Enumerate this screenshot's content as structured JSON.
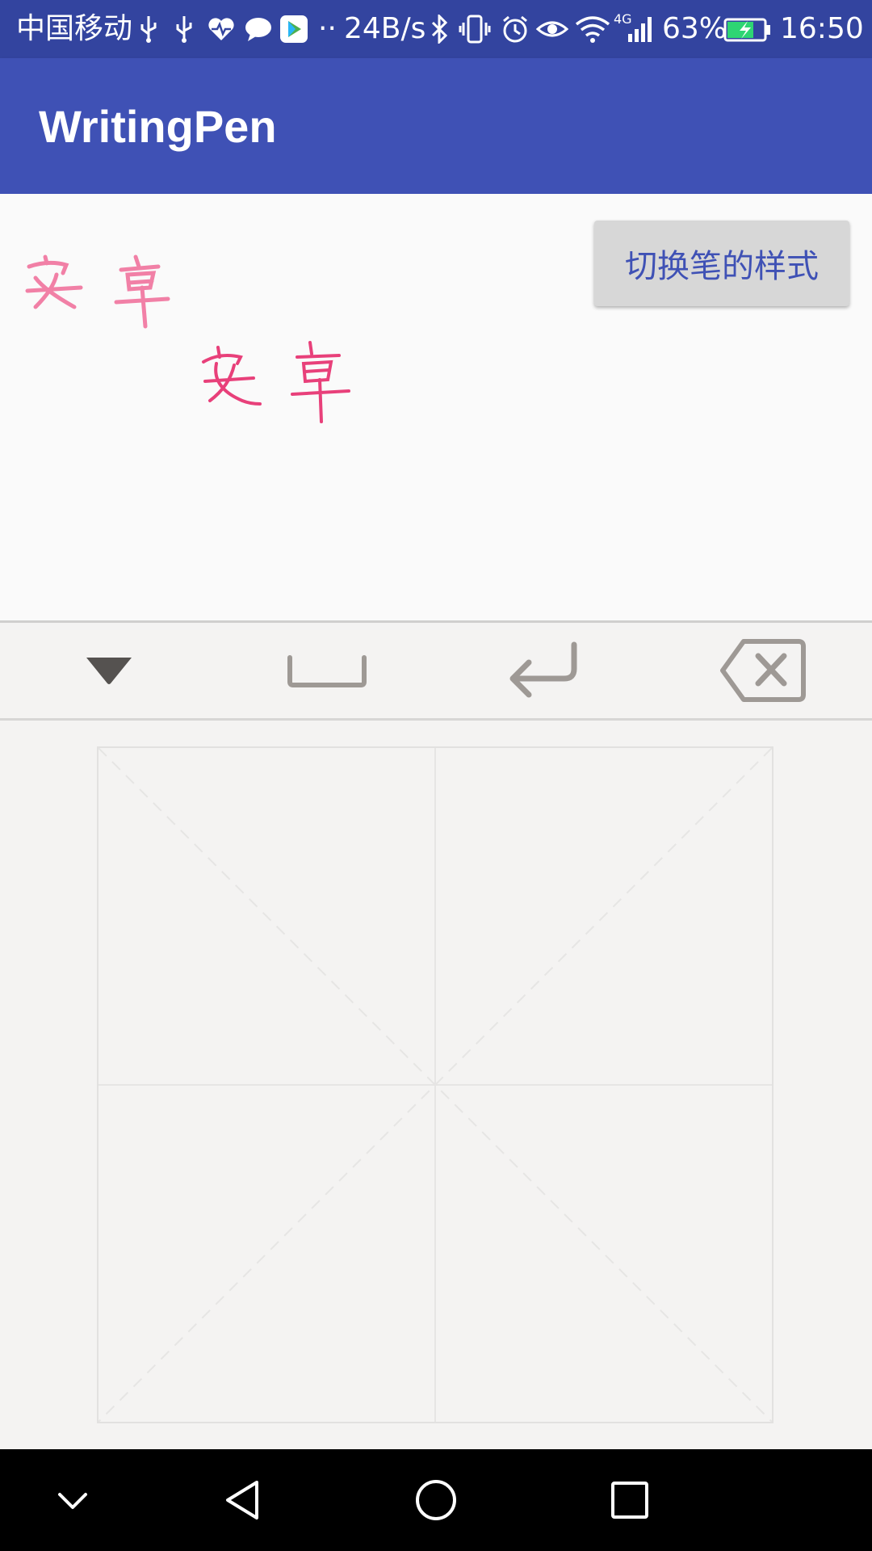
{
  "status_bar": {
    "carrier": "中国移动",
    "network_speed": "24B/s",
    "network_type": "4G",
    "battery": "63%",
    "time": "16:50",
    "icons": [
      "usb-icon",
      "usb-icon",
      "heart-rate-icon",
      "chat-bubble-icon",
      "play-store-icon",
      "more-dots-icon",
      "bluetooth-icon",
      "vibrate-icon",
      "alarm-icon",
      "eye-icon",
      "wifi-icon",
      "signal-icon",
      "battery-charging-icon"
    ]
  },
  "app_bar": {
    "title": "WritingPen"
  },
  "content": {
    "switch_button_label": "切换笔的样式",
    "handwriting_samples": [
      "安 卓",
      "安 卓"
    ],
    "ink_color": "#e8407a"
  },
  "keyboard_toolbar": {
    "keys": [
      "collapse-icon",
      "space-icon",
      "enter-icon",
      "backspace-icon"
    ]
  },
  "handwriting_pad": {
    "grid": "rice-grid"
  },
  "nav_bar": {
    "buttons": [
      "hide-keyboard-icon",
      "back-icon",
      "home-icon",
      "recents-icon"
    ]
  },
  "colors": {
    "status_bar": "#33449f",
    "app_bar": "#3f51b5",
    "accent_text": "#3f51b5",
    "button_bg": "#d7d7d7",
    "keyboard_bg": "#f4f3f2",
    "icon_gray": "#9e9995"
  }
}
